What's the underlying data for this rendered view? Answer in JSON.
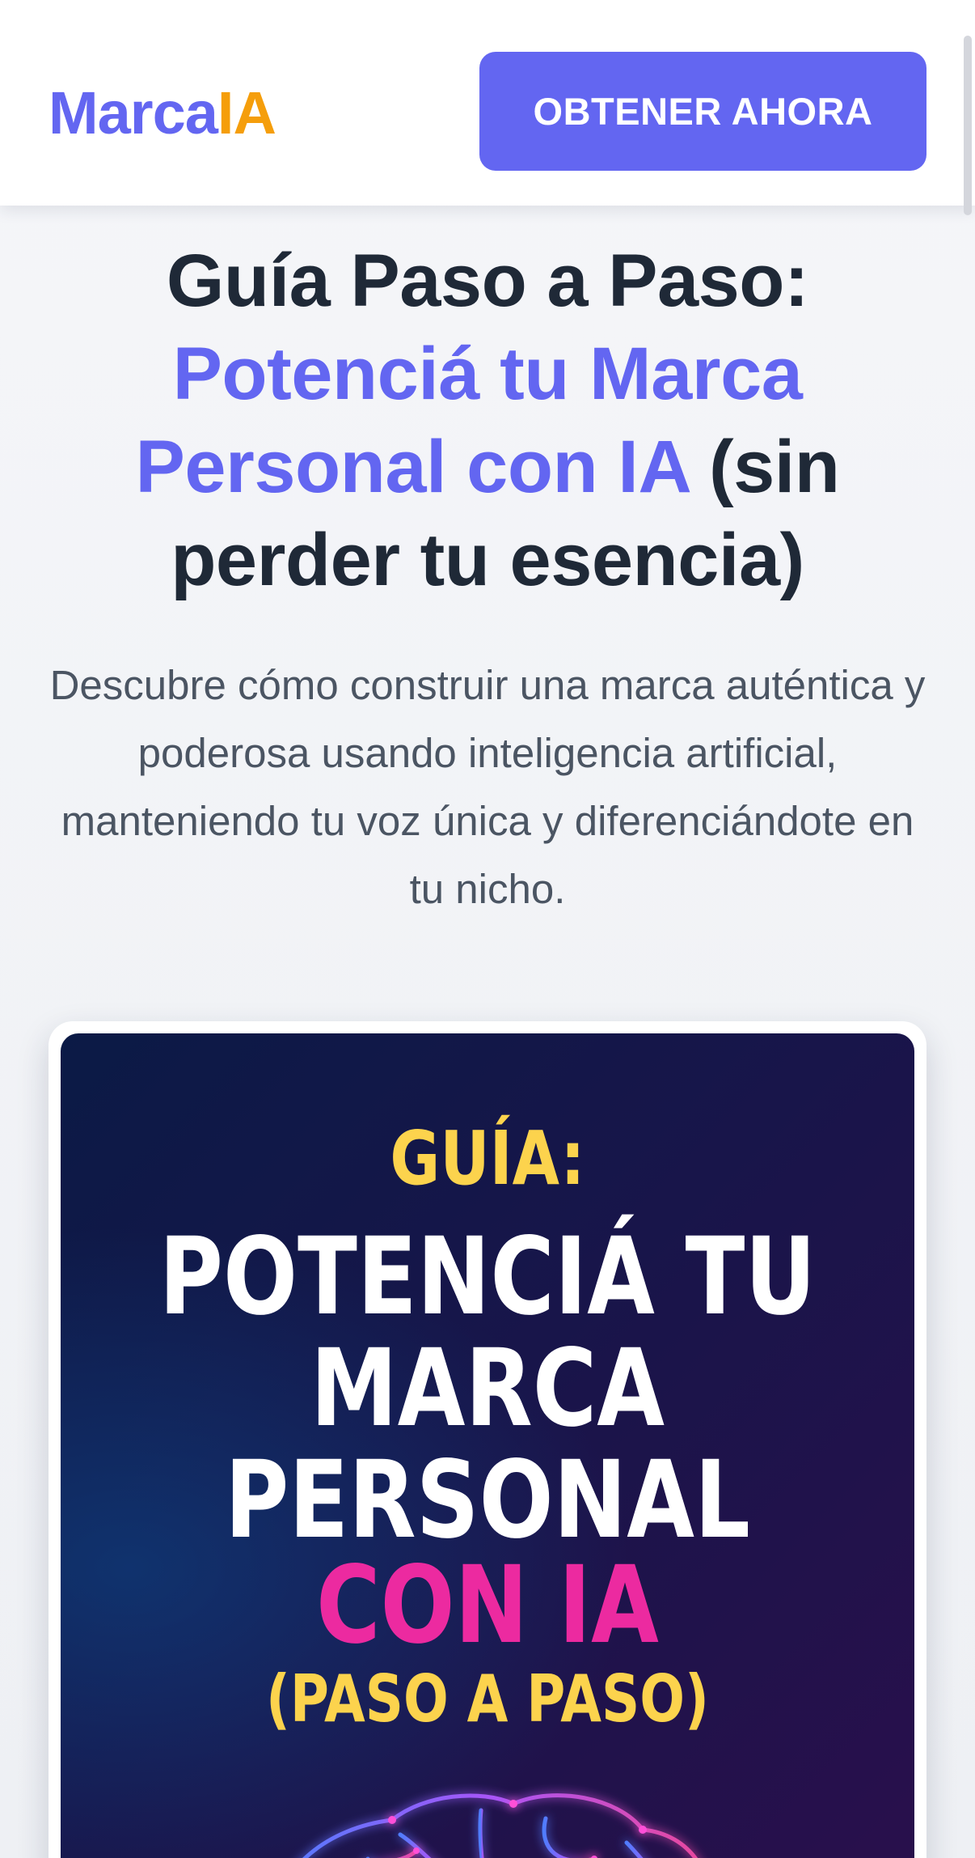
{
  "header": {
    "logo_part1": "Marca",
    "logo_part2": "IA",
    "cta_label": "OBTENER AHORA"
  },
  "hero": {
    "title_line1": "Guía Paso a Paso:",
    "title_accent": "Potenciá tu Marca Personal con IA",
    "title_tail": "(sin perder tu esencia)",
    "subtitle": "Descubre cómo construir una marca auténtica y poderosa usando inteligencia artificial, manteniendo tu voz única y diferenciándote en tu nicho."
  },
  "cover": {
    "kicker": "GUÍA:",
    "title_lines": [
      "POTENCIÁ TU",
      "MARCA",
      "PERSONAL"
    ],
    "accent": "CON IA",
    "sub": "(PASO A PASO)",
    "illustration_icon": "glowing-brain-icon"
  },
  "colors": {
    "brand": "#6366f1",
    "logo_accent": "#f59e0b",
    "heading": "#1f2937",
    "body_text": "#4b5563",
    "cover_yellow": "#fcd34d",
    "cover_pink": "#ec2aa0"
  }
}
